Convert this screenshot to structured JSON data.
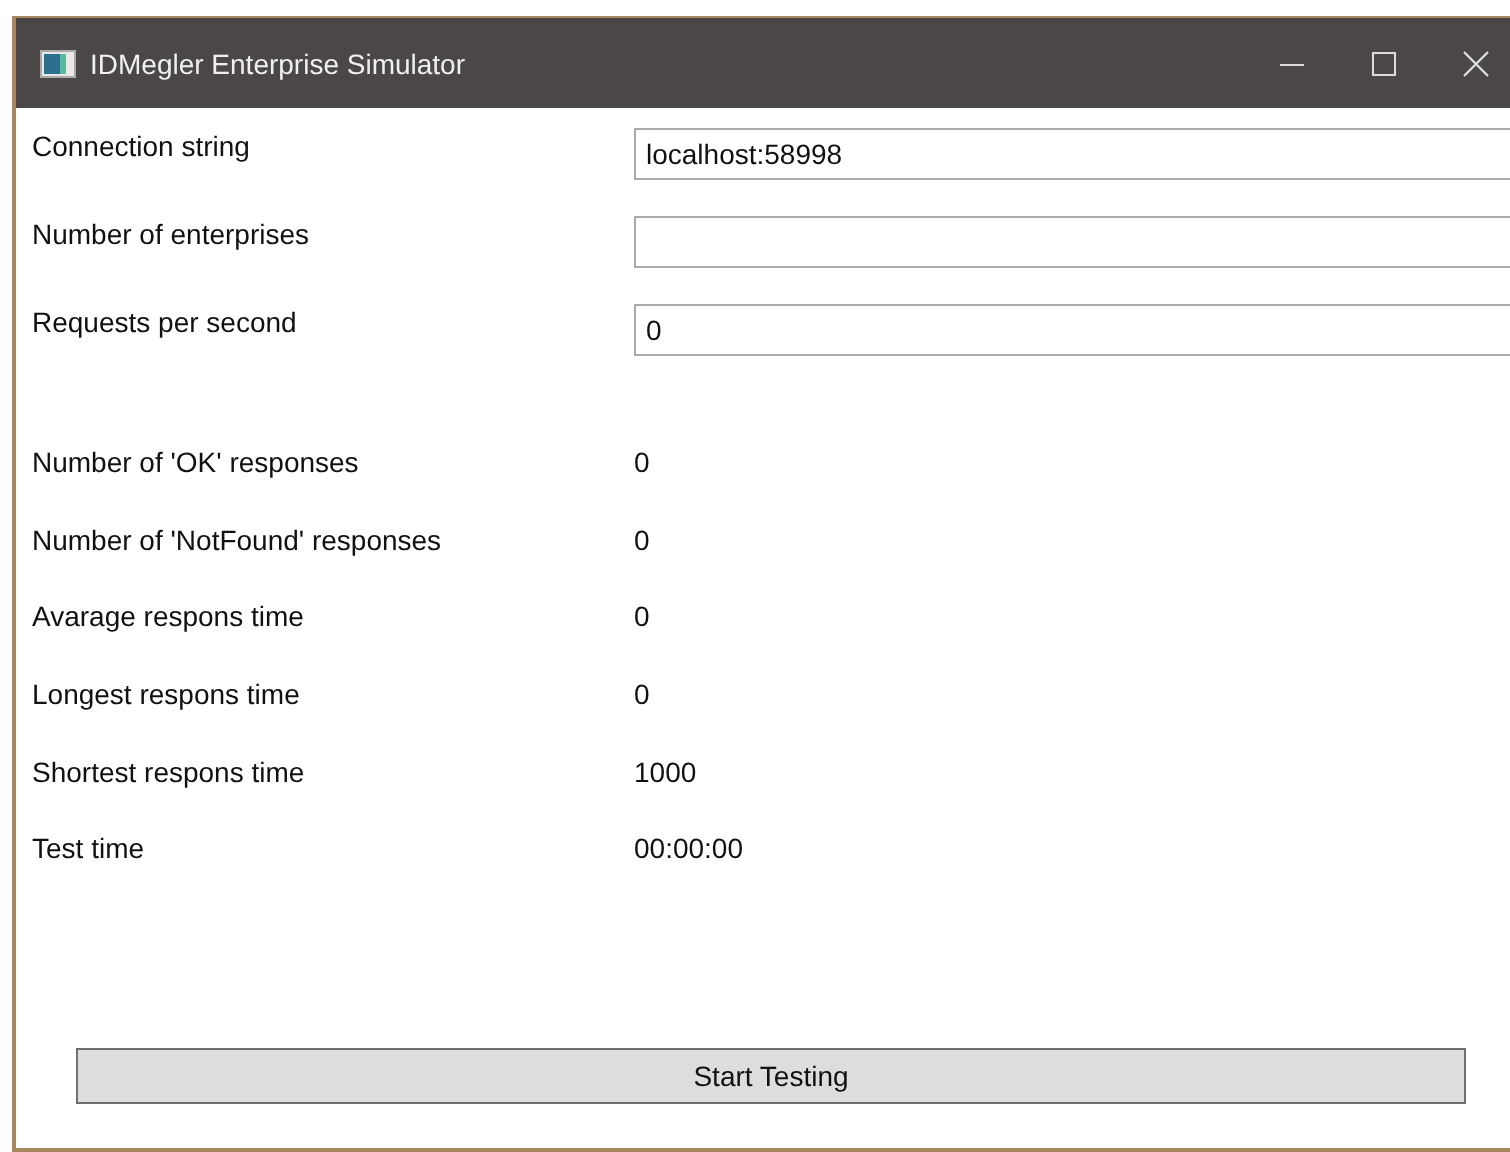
{
  "window": {
    "title": "IDMegler Enterprise Simulator"
  },
  "fields": [
    {
      "label": "Connection string",
      "value": "localhost:58998"
    },
    {
      "label": "Number of enterprises"
    },
    {
      "label": "Requests per second",
      "value": "0"
    }
  ],
  "stats": [
    {
      "label": "Number of 'OK' responses",
      "value": "0"
    },
    {
      "label": "Number of 'NotFound' responses",
      "value": "0"
    },
    {
      "label": "Avarage respons time",
      "value": "0"
    },
    {
      "label": "Longest respons time",
      "value": "0"
    },
    {
      "label": "Shortest respons time",
      "value": "1000"
    },
    {
      "label": "Test time",
      "value": "00:00:00"
    }
  ],
  "button": "Start Testing"
}
